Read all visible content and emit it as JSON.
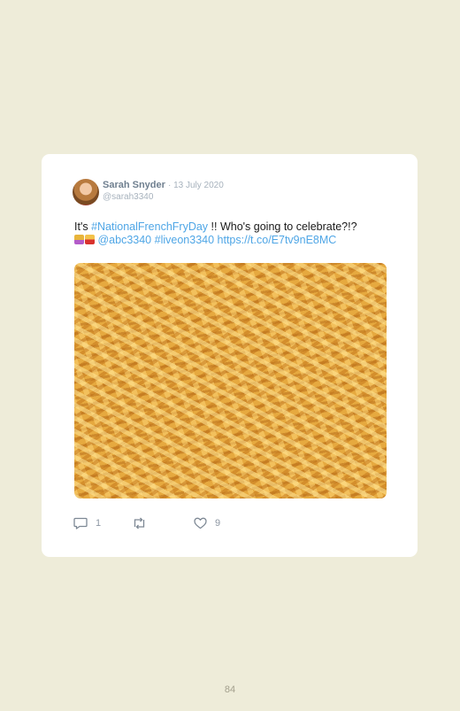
{
  "tweet": {
    "author_name": "Sarah Snyder",
    "date": "· 13 July 2020",
    "handle": "@sarah3340",
    "text_prefix": "It's ",
    "hashtag_main": "#NationalFrenchFryDay",
    "text_mid": " !! Who's going to celebrate?!?",
    "emojis": [
      "fries-emoji",
      "fries-emoji"
    ],
    "mention": "@abc3340",
    "hashtag_second": "#liveon3340",
    "link": "https://t.co/E7tv9nE8MC",
    "image_alt": "photo of french fries"
  },
  "actions": {
    "reply_count": "1",
    "retweet_count": "",
    "like_count": "9"
  },
  "colors": {
    "background": "#eeecd9",
    "card": "#ffffff",
    "link": "#4fa6e6",
    "muted": "#a7b2bd"
  },
  "page": {
    "number": "84"
  }
}
